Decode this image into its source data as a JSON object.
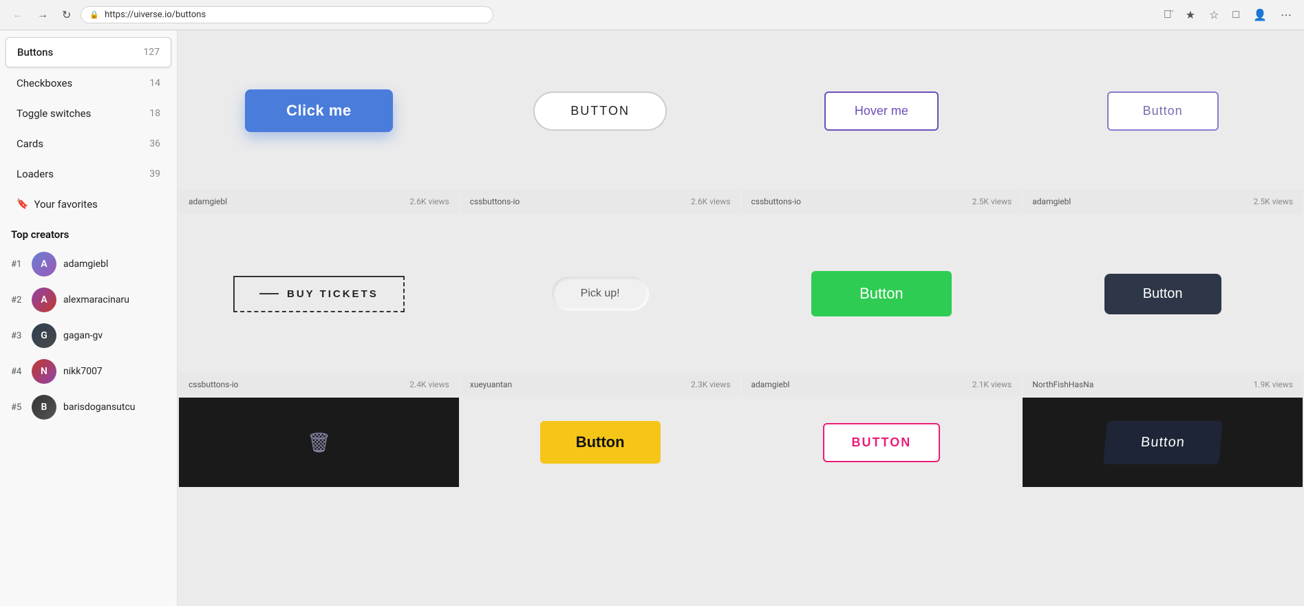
{
  "browser": {
    "url": "https://uiverse.io/buttons",
    "back_title": "Back",
    "forward_title": "Forward",
    "refresh_title": "Refresh"
  },
  "sidebar": {
    "items": [
      {
        "id": "buttons",
        "label": "Buttons",
        "count": "127",
        "active": true,
        "icon": null
      },
      {
        "id": "checkboxes",
        "label": "Checkboxes",
        "count": "14",
        "active": false,
        "icon": null
      },
      {
        "id": "toggle-switches",
        "label": "Toggle switches",
        "count": "18",
        "active": false,
        "icon": null
      },
      {
        "id": "cards",
        "label": "Cards",
        "count": "36",
        "active": false,
        "icon": null
      },
      {
        "id": "loaders",
        "label": "Loaders",
        "count": "39",
        "active": false,
        "icon": null
      },
      {
        "id": "favorites",
        "label": "Your favorites",
        "count": "",
        "active": false,
        "icon": "bookmark"
      }
    ],
    "top_creators_heading": "Top creators",
    "creators": [
      {
        "rank": "#1",
        "name": "adamgiebl",
        "avatar_class": "avatar-blue"
      },
      {
        "rank": "#2",
        "name": "alexmaracinaru",
        "avatar_class": "avatar-purple"
      },
      {
        "rank": "#3",
        "name": "gagan-gv",
        "avatar_class": "avatar-dark"
      },
      {
        "rank": "#4",
        "name": "nikk7007",
        "avatar_class": "avatar-warm"
      },
      {
        "rank": "#5",
        "name": "barisdogansutcu",
        "avatar_class": "avatar-darkgray"
      }
    ]
  },
  "grid": {
    "cards": [
      {
        "id": "card-1",
        "button_label": "Click me",
        "author": "adamgiebl",
        "views": "2.6K views",
        "type": "click-me",
        "dark": false
      },
      {
        "id": "card-2",
        "button_label": "BUTTON",
        "author": "cssbuttons-io",
        "views": "2.6K views",
        "type": "button-rounded",
        "dark": false
      },
      {
        "id": "card-3",
        "button_label": "Hover me",
        "author": "cssbuttons-io",
        "views": "2.5K views",
        "type": "hover-me",
        "dark": false
      },
      {
        "id": "card-4",
        "button_label": "Button",
        "author": "adamgiebl",
        "views": "2.5K views",
        "type": "button-outline",
        "dark": false
      },
      {
        "id": "card-5",
        "button_label": "BUY TICKETS",
        "author": "cssbuttons-io",
        "views": "2.4K views",
        "type": "buy-tickets",
        "dark": false
      },
      {
        "id": "card-6",
        "button_label": "Pick up!",
        "author": "xueyuantan",
        "views": "2.3K views",
        "type": "pick-up",
        "dark": false
      },
      {
        "id": "card-7",
        "button_label": "Button",
        "author": "adamgiebl",
        "views": "2.1K views",
        "type": "green",
        "dark": false
      },
      {
        "id": "card-8",
        "button_label": "Button",
        "author": "NorthFishHasNa",
        "views": "1.9K views",
        "type": "dark-navy",
        "dark": false
      },
      {
        "id": "card-9",
        "button_label": "🗑",
        "author": "",
        "views": "",
        "type": "trash-dark",
        "dark": true
      },
      {
        "id": "card-10",
        "button_label": "Button",
        "author": "",
        "views": "",
        "type": "yellow",
        "dark": false
      },
      {
        "id": "card-11",
        "button_label": "BUTTON",
        "author": "",
        "views": "",
        "type": "pink-outline",
        "dark": false
      },
      {
        "id": "card-12",
        "button_label": "Button",
        "author": "",
        "views": "",
        "type": "dark-diagonal",
        "dark": true
      }
    ]
  }
}
